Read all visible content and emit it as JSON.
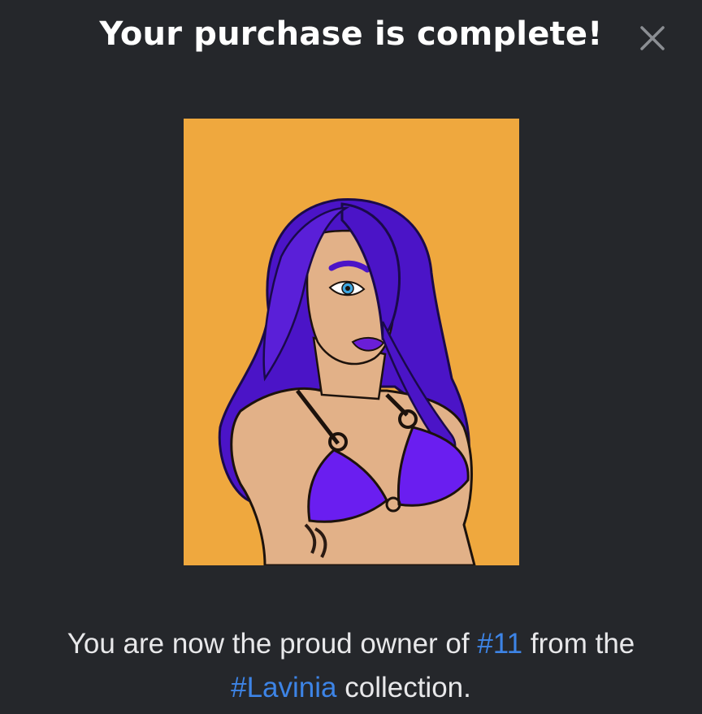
{
  "modal": {
    "title": "Your purchase is complete!",
    "close_icon": "close-icon",
    "artwork_icon": "nft-artwork-image"
  },
  "caption": {
    "prefix": "You are now the proud owner of ",
    "item_number": "#11",
    "middle": " from the",
    "collection": "#Lavinia",
    "suffix": " collection."
  },
  "colors": {
    "background": "#25272b",
    "artwork_background": "#efa83e",
    "link": "#3d84e6",
    "title": "#ffffff"
  }
}
